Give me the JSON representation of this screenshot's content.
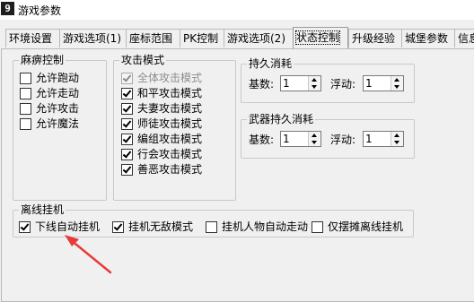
{
  "window": {
    "icon_char": "9",
    "title": "游戏参数"
  },
  "tabs": [
    {
      "label": "环境设置"
    },
    {
      "label": "游戏选项(1)"
    },
    {
      "label": "座标范围"
    },
    {
      "label": "PK控制"
    },
    {
      "label": "游戏选项(2)"
    },
    {
      "label": "状态控制",
      "active": true
    },
    {
      "label": "升级经验"
    },
    {
      "label": "城堡参数"
    },
    {
      "label": "信息"
    }
  ],
  "paralysis": {
    "title": "麻痹控制",
    "items": [
      {
        "label": "允许跑动",
        "checked": false
      },
      {
        "label": "允许走动",
        "checked": false
      },
      {
        "label": "允许攻击",
        "checked": false
      },
      {
        "label": "允许魔法",
        "checked": false
      }
    ]
  },
  "attack_mode": {
    "title": "攻击模式",
    "items": [
      {
        "label": "全体攻击模式",
        "checked": true,
        "disabled": true
      },
      {
        "label": "和平攻击模式",
        "checked": true
      },
      {
        "label": "夫妻攻击模式",
        "checked": true
      },
      {
        "label": "师徒攻击模式",
        "checked": true
      },
      {
        "label": "编组攻击模式",
        "checked": true
      },
      {
        "label": "行会攻击模式",
        "checked": true
      },
      {
        "label": "善恶攻击模式",
        "checked": true
      }
    ]
  },
  "durability": {
    "title": "持久消耗",
    "base_label": "基数:",
    "base_value": "1",
    "float_label": "浮动:",
    "float_value": "1"
  },
  "weapon_durability": {
    "title": "武器持久消耗",
    "base_label": "基数:",
    "base_value": "1",
    "float_label": "浮动:",
    "float_value": "1"
  },
  "offline": {
    "title": "离线挂机",
    "items": [
      {
        "label": "下线自动挂机",
        "checked": true
      },
      {
        "label": "挂机无敌模式",
        "checked": true
      },
      {
        "label": "挂机人物自动走动",
        "checked": false
      },
      {
        "label": "仅摆摊离线挂机",
        "checked": false
      }
    ]
  },
  "annotation": {
    "arrow_color": "#e83a3a"
  }
}
